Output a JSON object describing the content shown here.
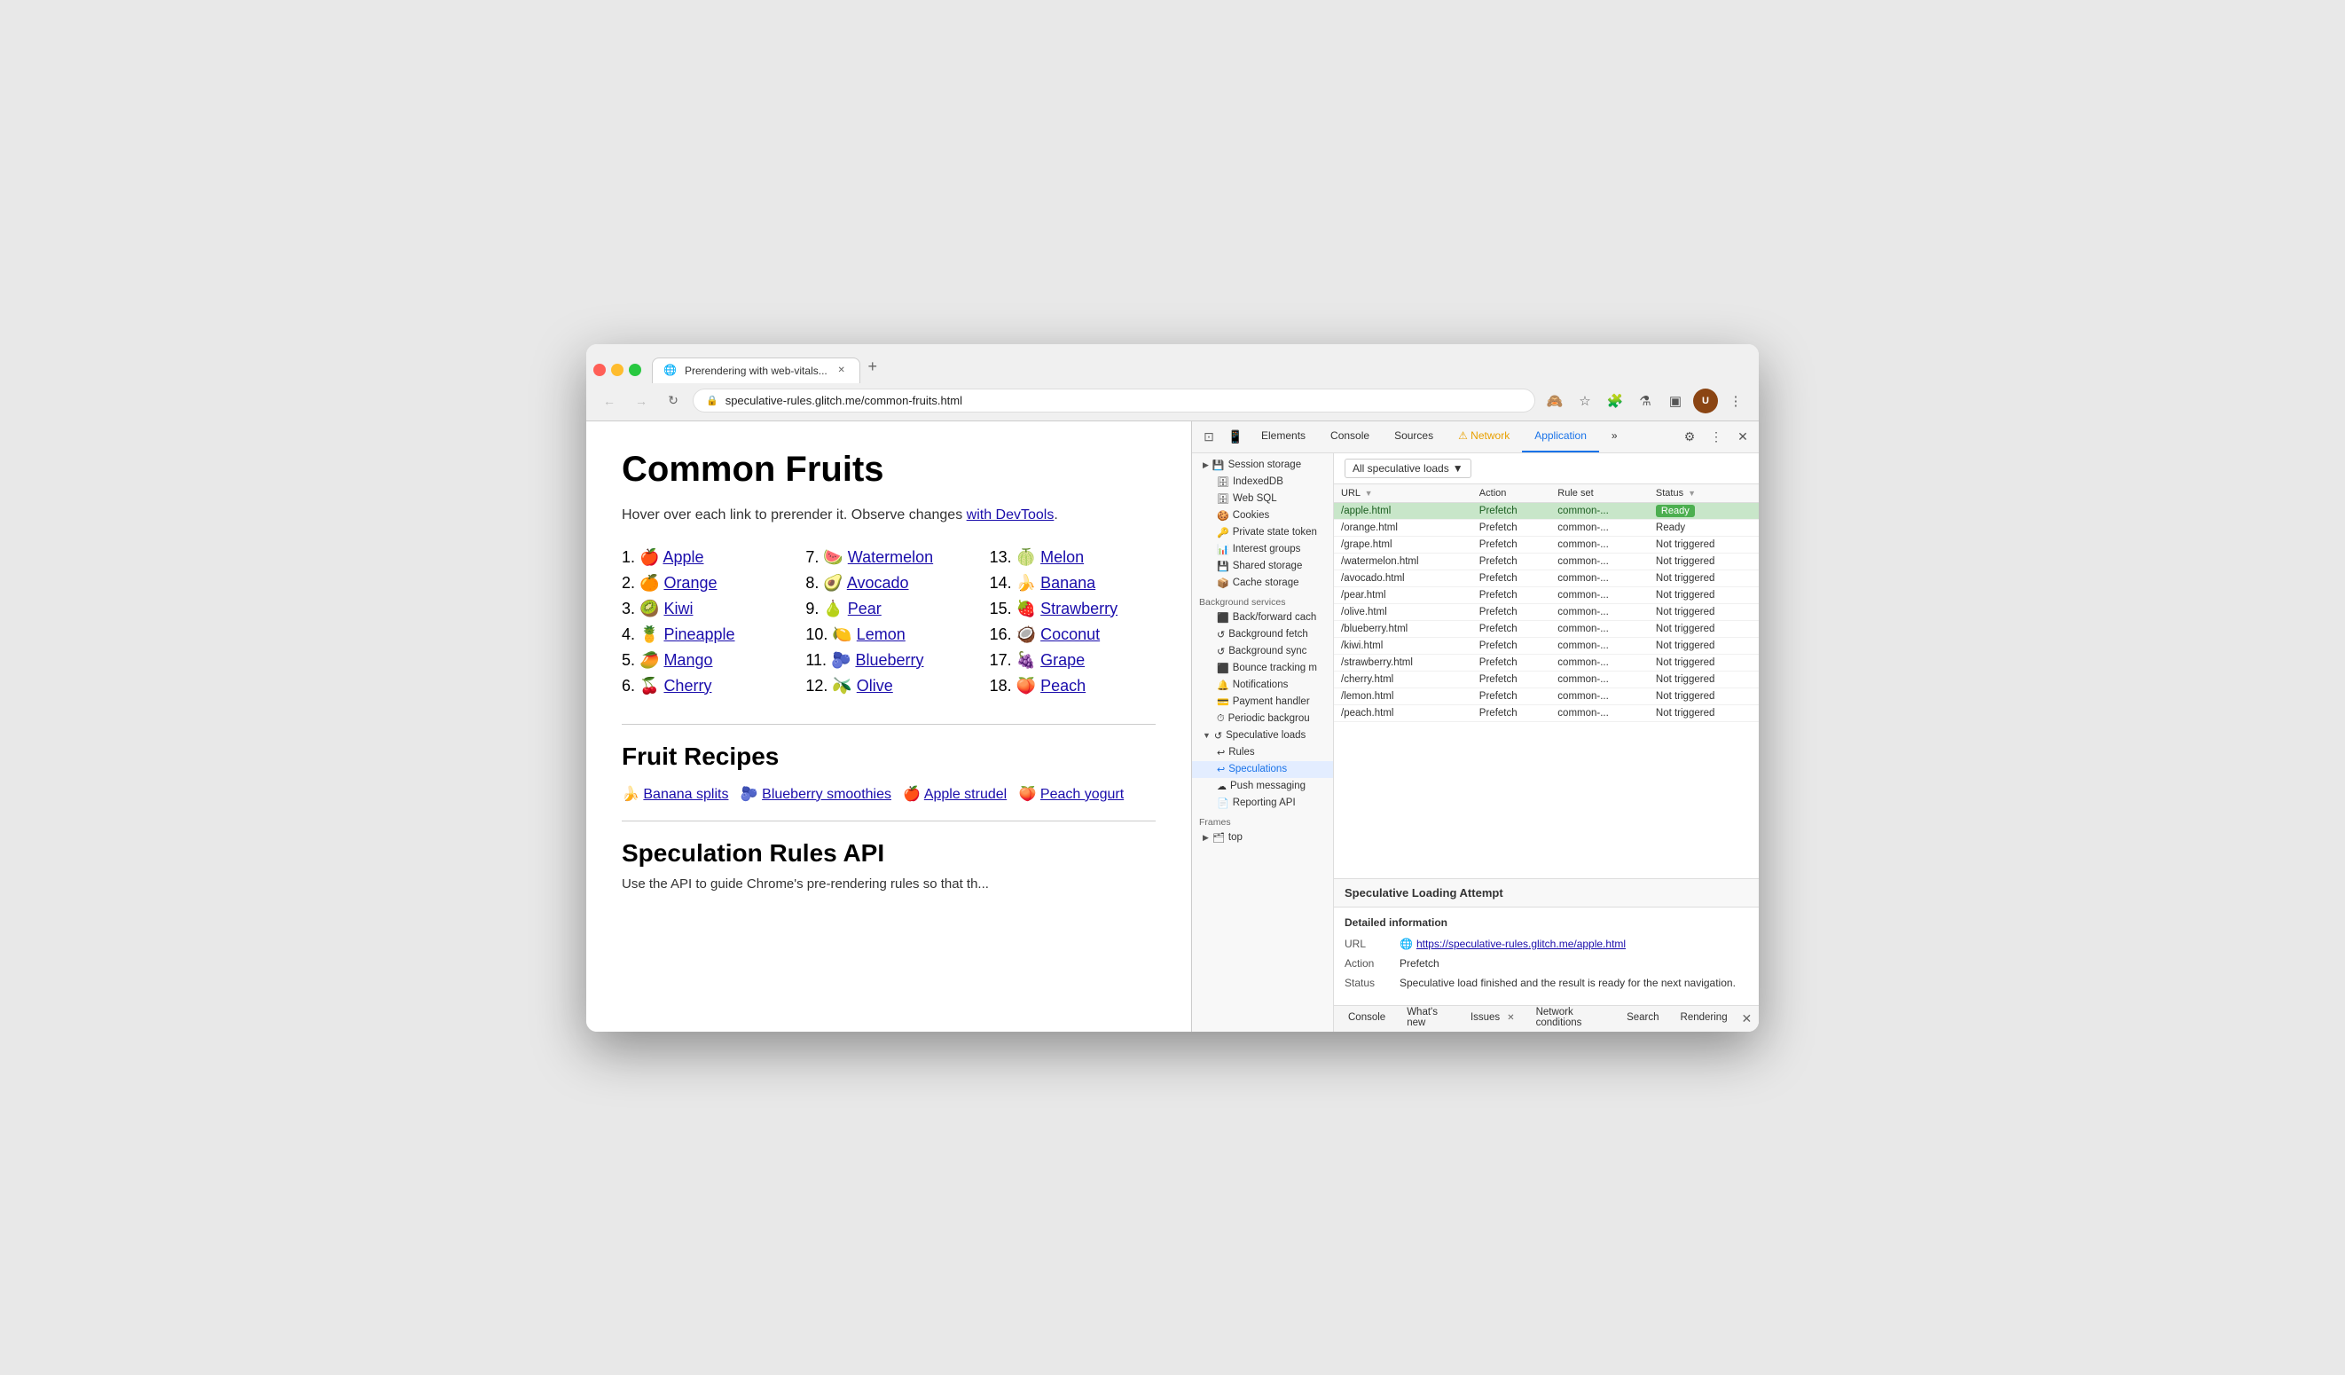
{
  "browser": {
    "tab_title": "Prerendering with web-vitals...",
    "tab_favicon": "🌐",
    "url": "speculative-rules.glitch.me/common-fruits.html",
    "new_tab_label": "+"
  },
  "page": {
    "title": "Common Fruits",
    "subtitle_text": "Hover over each link to prerender it. Observe changes ",
    "subtitle_link": "with DevTools",
    "subtitle_end": ".",
    "fruits": [
      {
        "num": "1.",
        "emoji": "🍎",
        "name": "Apple",
        "href": "apple.html"
      },
      {
        "num": "2.",
        "emoji": "🍊",
        "name": "Orange",
        "href": "orange.html"
      },
      {
        "num": "3.",
        "emoji": "🥝",
        "name": "Kiwi",
        "href": "kiwi.html"
      },
      {
        "num": "4.",
        "emoji": "🍍",
        "name": "Pineapple",
        "href": "pineapple.html"
      },
      {
        "num": "5.",
        "emoji": "🥭",
        "name": "Mango",
        "href": "mango.html"
      },
      {
        "num": "6.",
        "emoji": "🍒",
        "name": "Cherry",
        "href": "cherry.html"
      },
      {
        "num": "7.",
        "emoji": "🍉",
        "name": "Watermelon",
        "href": "watermelon.html"
      },
      {
        "num": "8.",
        "emoji": "🥑",
        "name": "Avocado",
        "href": "avocado.html"
      },
      {
        "num": "9.",
        "emoji": "🍐",
        "name": "Pear",
        "href": "pear.html"
      },
      {
        "num": "10.",
        "emoji": "🍋",
        "name": "Lemon",
        "href": "lemon.html"
      },
      {
        "num": "11.",
        "emoji": "🫐",
        "name": "Blueberry",
        "href": "blueberry.html"
      },
      {
        "num": "12.",
        "emoji": "🫒",
        "name": "Olive",
        "href": "olive.html"
      },
      {
        "num": "13.",
        "emoji": "🍈",
        "name": "Melon",
        "href": "melon.html"
      },
      {
        "num": "14.",
        "emoji": "🍌",
        "name": "Banana",
        "href": "banana.html"
      },
      {
        "num": "15.",
        "emoji": "🍓",
        "name": "Strawberry",
        "href": "strawberry.html"
      },
      {
        "num": "16.",
        "emoji": "🥥",
        "name": "Coconut",
        "href": "coconut.html"
      },
      {
        "num": "17.",
        "emoji": "🍇",
        "name": "Grape",
        "href": "grape.html"
      },
      {
        "num": "18.",
        "emoji": "🍑",
        "name": "Peach",
        "href": "peach.html"
      }
    ],
    "recipes_title": "Fruit Recipes",
    "recipes": [
      {
        "emoji": "🍌",
        "name": "Banana splits"
      },
      {
        "emoji": "🫐",
        "name": "Blueberry smoothies"
      },
      {
        "emoji": "🍎",
        "name": "Apple strudel"
      },
      {
        "emoji": "🍑",
        "name": "Peach yogurt"
      }
    ],
    "api_title": "Speculation Rules API",
    "api_desc": "Use the API to guide Chrome's pre-rendering rules so that th..."
  },
  "devtools": {
    "tabs": [
      "Elements",
      "Console",
      "Sources",
      "Network",
      "Application"
    ],
    "active_tab": "Application",
    "warning_tab": "Network",
    "more_label": "»",
    "sidebar": {
      "items": [
        {
          "label": "Session storage",
          "icon": "💾",
          "arrow": "▶"
        },
        {
          "label": "IndexedDB",
          "icon": "🗄️"
        },
        {
          "label": "Web SQL",
          "icon": "🗄️"
        },
        {
          "label": "Cookies",
          "icon": "🍪"
        },
        {
          "label": "Private state token",
          "icon": "🔑"
        },
        {
          "label": "Interest groups",
          "icon": "📊"
        },
        {
          "label": "Shared storage",
          "icon": "💾"
        },
        {
          "label": "Cache storage",
          "icon": "📦"
        },
        {
          "section": "Background services"
        },
        {
          "label": "Back/forward cach",
          "icon": "⬛"
        },
        {
          "label": "Background fetch",
          "icon": "↺"
        },
        {
          "label": "Background sync",
          "icon": "↺"
        },
        {
          "label": "Bounce tracking m",
          "icon": "⬛"
        },
        {
          "label": "Notifications",
          "icon": "🔔"
        },
        {
          "label": "Payment handler",
          "icon": "💳"
        },
        {
          "label": "Periodic backgrou",
          "icon": "⏱"
        },
        {
          "label": "Speculative loads",
          "icon": "↺",
          "arrow": "▼",
          "expanded": true
        },
        {
          "label": "Rules",
          "icon": "↩",
          "indent": true
        },
        {
          "label": "Speculations",
          "icon": "↩",
          "indent": true,
          "selected": true
        },
        {
          "label": "Push messaging",
          "icon": "☁"
        },
        {
          "label": "Reporting API",
          "icon": "📄"
        },
        {
          "section": "Frames"
        },
        {
          "label": "top",
          "icon": "▶ 🗂"
        }
      ]
    },
    "speculative_dropdown": "All speculative loads",
    "table": {
      "columns": [
        "URL",
        "Action",
        "Rule set",
        "Status"
      ],
      "rows": [
        {
          "url": "/apple.html",
          "action": "Prefetch",
          "ruleset": "common-...",
          "status": "Ready",
          "highlighted": true
        },
        {
          "url": "/orange.html",
          "action": "Prefetch",
          "ruleset": "common-...",
          "status": "Ready"
        },
        {
          "url": "/grape.html",
          "action": "Prefetch",
          "ruleset": "common-...",
          "status": "Not triggered"
        },
        {
          "url": "/watermelon.html",
          "action": "Prefetch",
          "ruleset": "common-...",
          "status": "Not triggered"
        },
        {
          "url": "/avocado.html",
          "action": "Prefetch",
          "ruleset": "common-...",
          "status": "Not triggered"
        },
        {
          "url": "/pear.html",
          "action": "Prefetch",
          "ruleset": "common-...",
          "status": "Not triggered"
        },
        {
          "url": "/olive.html",
          "action": "Prefetch",
          "ruleset": "common-...",
          "status": "Not triggered"
        },
        {
          "url": "/blueberry.html",
          "action": "Prefetch",
          "ruleset": "common-...",
          "status": "Not triggered"
        },
        {
          "url": "/kiwi.html",
          "action": "Prefetch",
          "ruleset": "common-...",
          "status": "Not triggered"
        },
        {
          "url": "/strawberry.html",
          "action": "Prefetch",
          "ruleset": "common-...",
          "status": "Not triggered"
        },
        {
          "url": "/cherry.html",
          "action": "Prefetch",
          "ruleset": "common-...",
          "status": "Not triggered"
        },
        {
          "url": "/lemon.html",
          "action": "Prefetch",
          "ruleset": "common-...",
          "status": "Not triggered"
        },
        {
          "url": "/peach.html",
          "action": "Prefetch",
          "ruleset": "common-...",
          "status": "Not triggered"
        }
      ]
    },
    "detail": {
      "title": "Speculative Loading Attempt",
      "section": "Detailed information",
      "url_label": "URL",
      "url_value": "https://speculative-rules.glitch.me/apple.html",
      "action_label": "Action",
      "action_value": "Prefetch",
      "status_label": "Status",
      "status_value": "Speculative load finished and the result is ready for the next navigation."
    },
    "bottom_tabs": [
      "Console",
      "What's new",
      "Issues",
      "Network conditions",
      "Search",
      "Rendering"
    ],
    "issues_count": "✕"
  }
}
